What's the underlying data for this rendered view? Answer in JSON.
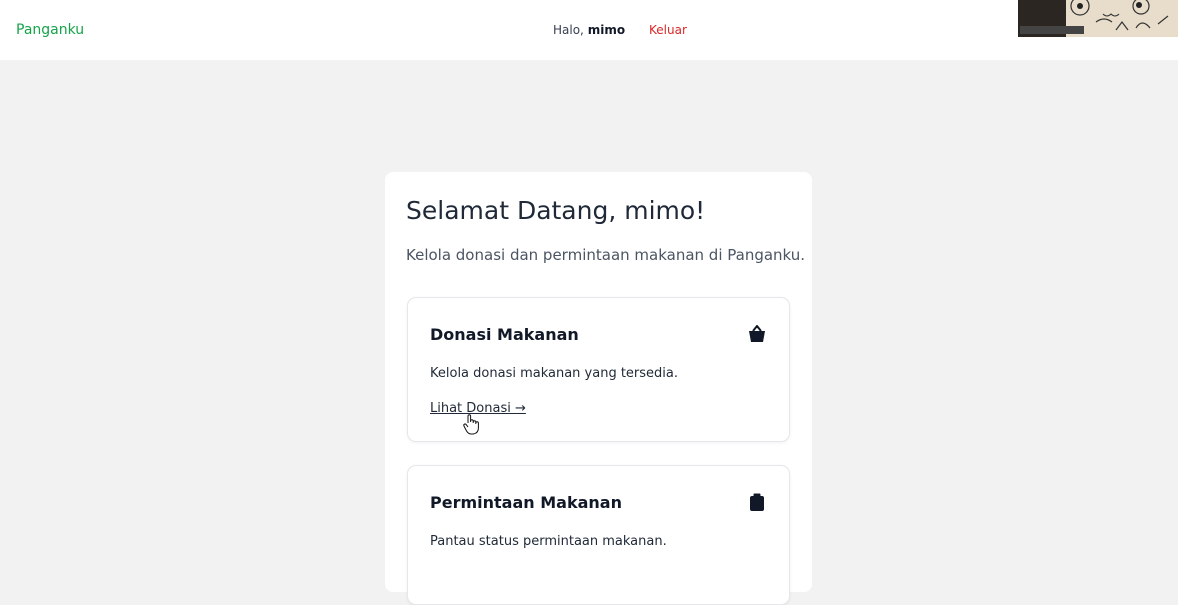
{
  "navbar": {
    "brand": "Panganku",
    "greeting_prefix": "Halo,",
    "username": "mimo",
    "logout_label": "Keluar"
  },
  "welcome": {
    "title": "Selamat Datang, mimo!",
    "subtitle": "Kelola donasi dan permintaan makanan di Panganku."
  },
  "features": [
    {
      "title": "Donasi Makanan",
      "description": "Kelola donasi makanan yang tersedia.",
      "link": "Lihat Donasi →",
      "icon": "basket-icon"
    },
    {
      "title": "Permintaan Makanan",
      "description": "Pantau status permintaan makanan.",
      "icon": "clipboard-icon"
    }
  ],
  "colors": {
    "brand": "#16a34a",
    "logout": "#dc2626",
    "background": "#f2f2f2"
  }
}
